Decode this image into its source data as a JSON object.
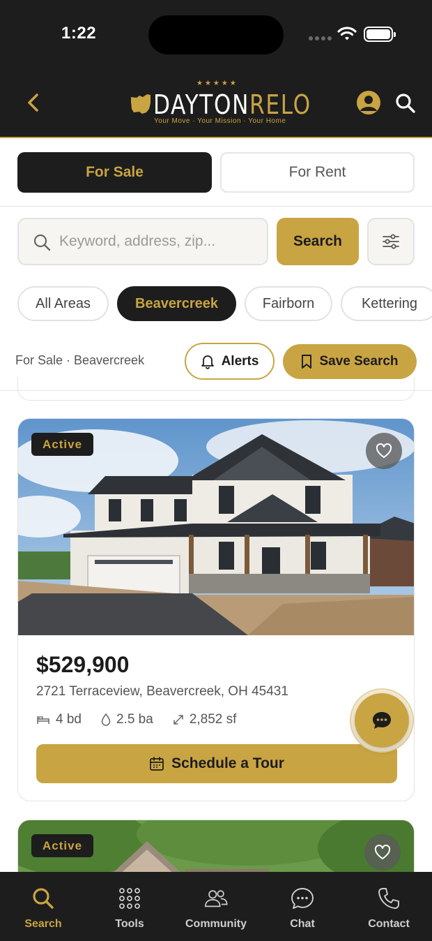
{
  "status_bar": {
    "time": "1:22"
  },
  "header": {
    "logo": {
      "stars": "★★★★★",
      "word_part1": "DAYTON",
      "word_part2": "RELO",
      "tagline": "Your Move · Your Mission · Your Home"
    },
    "back_icon": "chevron-left-icon",
    "profile_icon": "user-circle-icon",
    "search_icon": "search-icon"
  },
  "tabs": [
    {
      "label": "For Sale",
      "active": true
    },
    {
      "label": "For Rent",
      "active": false
    }
  ],
  "search": {
    "placeholder": "Keyword, address, zip...",
    "value": "",
    "button_label": "Search",
    "filter_icon": "sliders-icon"
  },
  "areas": [
    {
      "label": "All Areas",
      "active": false
    },
    {
      "label": "Beavercreek",
      "active": true
    },
    {
      "label": "Fairborn",
      "active": false
    },
    {
      "label": "Kettering",
      "active": false
    }
  ],
  "context": {
    "label": "For Sale · Beavercreek",
    "alerts_label": "Alerts",
    "save_search_label": "Save Search"
  },
  "listings": [
    {
      "status": "Active",
      "price": "$529,900",
      "address": "2721 Terraceview, Beavercreek, OH 45431",
      "beds": "4 bd",
      "baths": "2.5 ba",
      "sqft": "2,852 sf",
      "tour_label": "Schedule a Tour"
    },
    {
      "status": "Active"
    }
  ],
  "nav": [
    {
      "label": "Search",
      "icon": "search-icon",
      "active": true
    },
    {
      "label": "Tools",
      "icon": "grid-dots-icon",
      "active": false
    },
    {
      "label": "Community",
      "icon": "people-icon",
      "active": false
    },
    {
      "label": "Chat",
      "icon": "chat-bubble-icon",
      "active": false
    },
    {
      "label": "Contact",
      "icon": "phone-icon",
      "active": false
    }
  ],
  "colors": {
    "brand_gold": "#c9a443",
    "dark": "#1d1d1d"
  }
}
